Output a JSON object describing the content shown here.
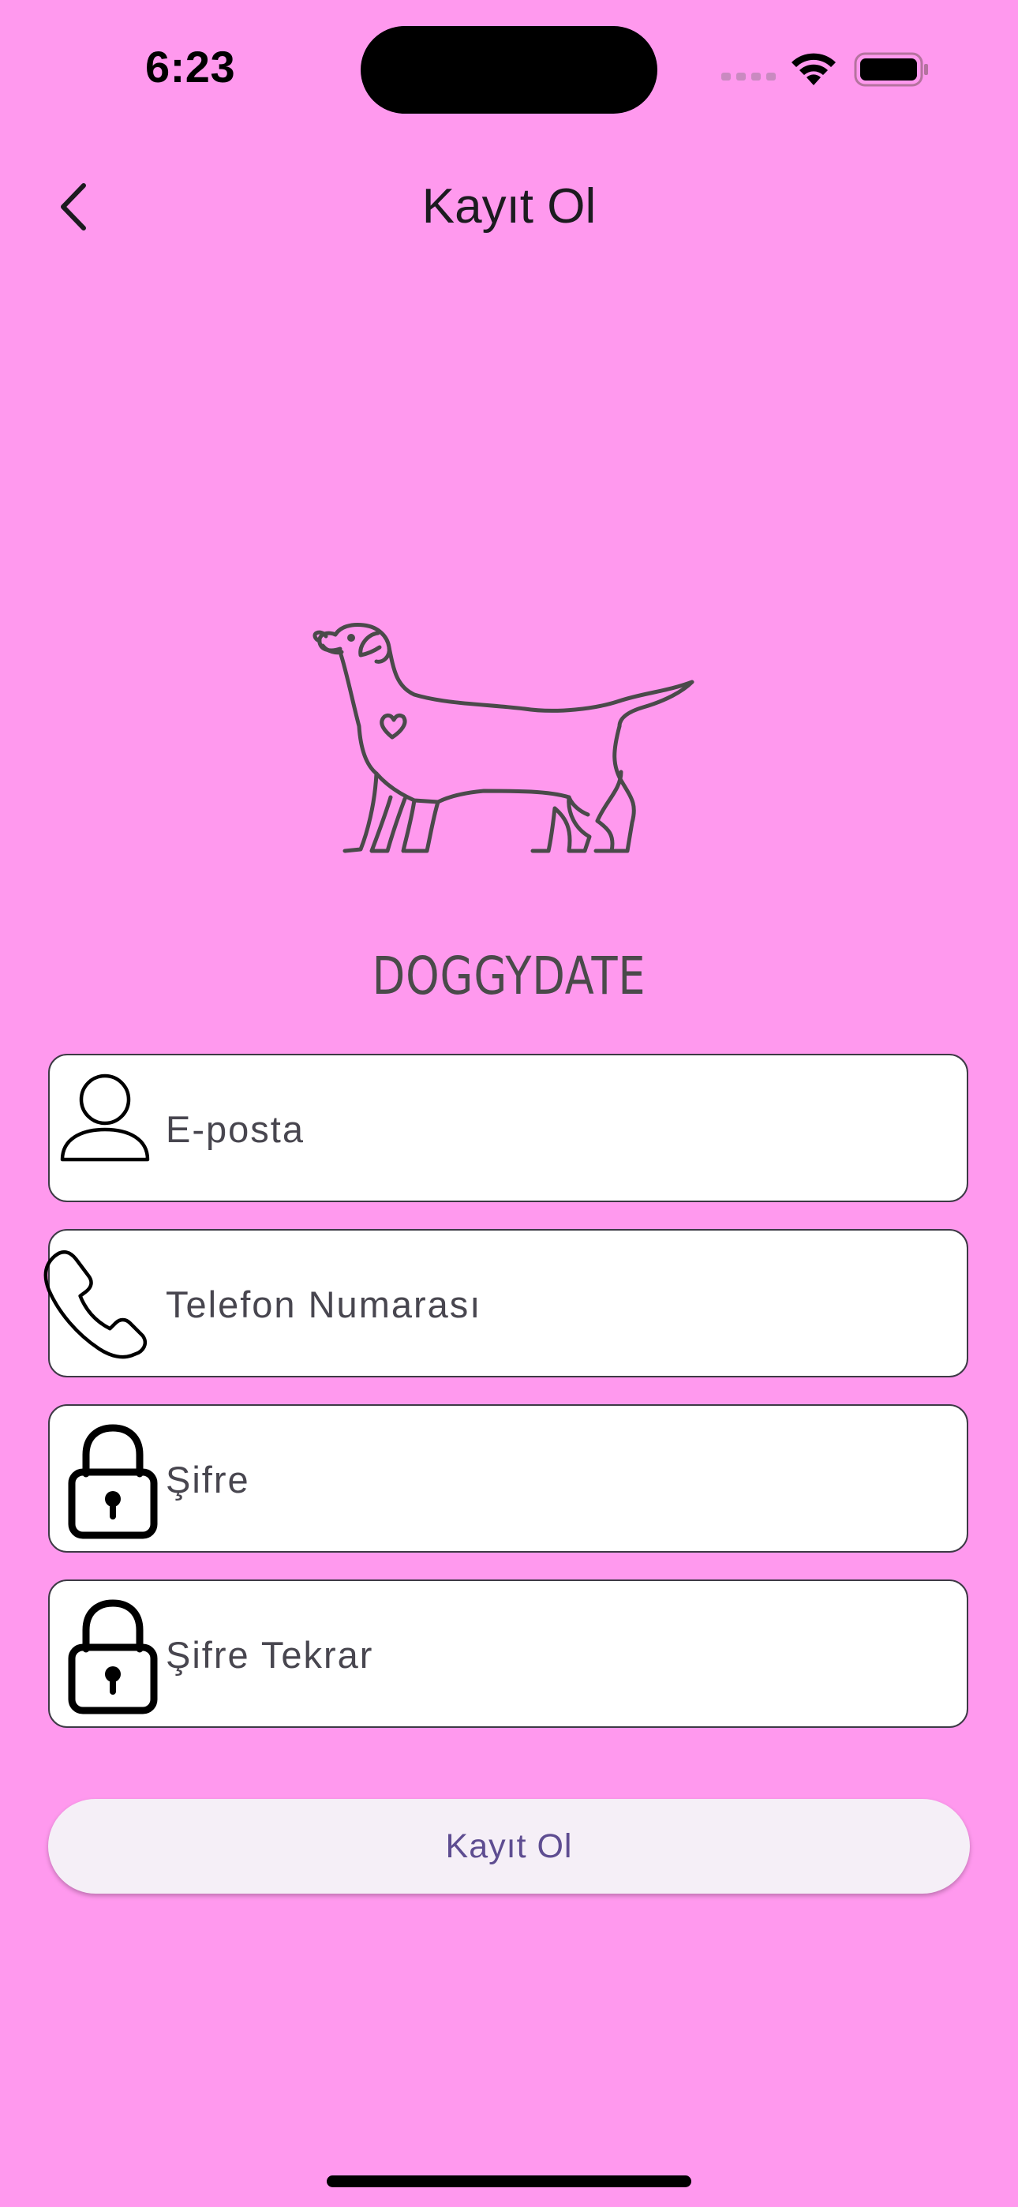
{
  "status_bar": {
    "time": "6:23"
  },
  "nav": {
    "title": "Kayıt Ol",
    "back_icon": "chevron-left-icon"
  },
  "logo": {
    "icon": "dog-heart-icon",
    "brand": "DOGGYDATE"
  },
  "form": {
    "fields": [
      {
        "placeholder": "E-posta",
        "icon": "user-icon",
        "value": ""
      },
      {
        "placeholder": "Telefon Numarası",
        "icon": "phone-icon",
        "value": ""
      },
      {
        "placeholder": "Şifre",
        "icon": "lock-icon",
        "value": ""
      },
      {
        "placeholder": "Şifre Tekrar",
        "icon": "lock-icon",
        "value": ""
      }
    ],
    "submit_label": "Kayıt Ol"
  },
  "colors": {
    "background": "#FF99EE",
    "button_background": "#F5EFF7",
    "button_text": "#5E4D91"
  }
}
